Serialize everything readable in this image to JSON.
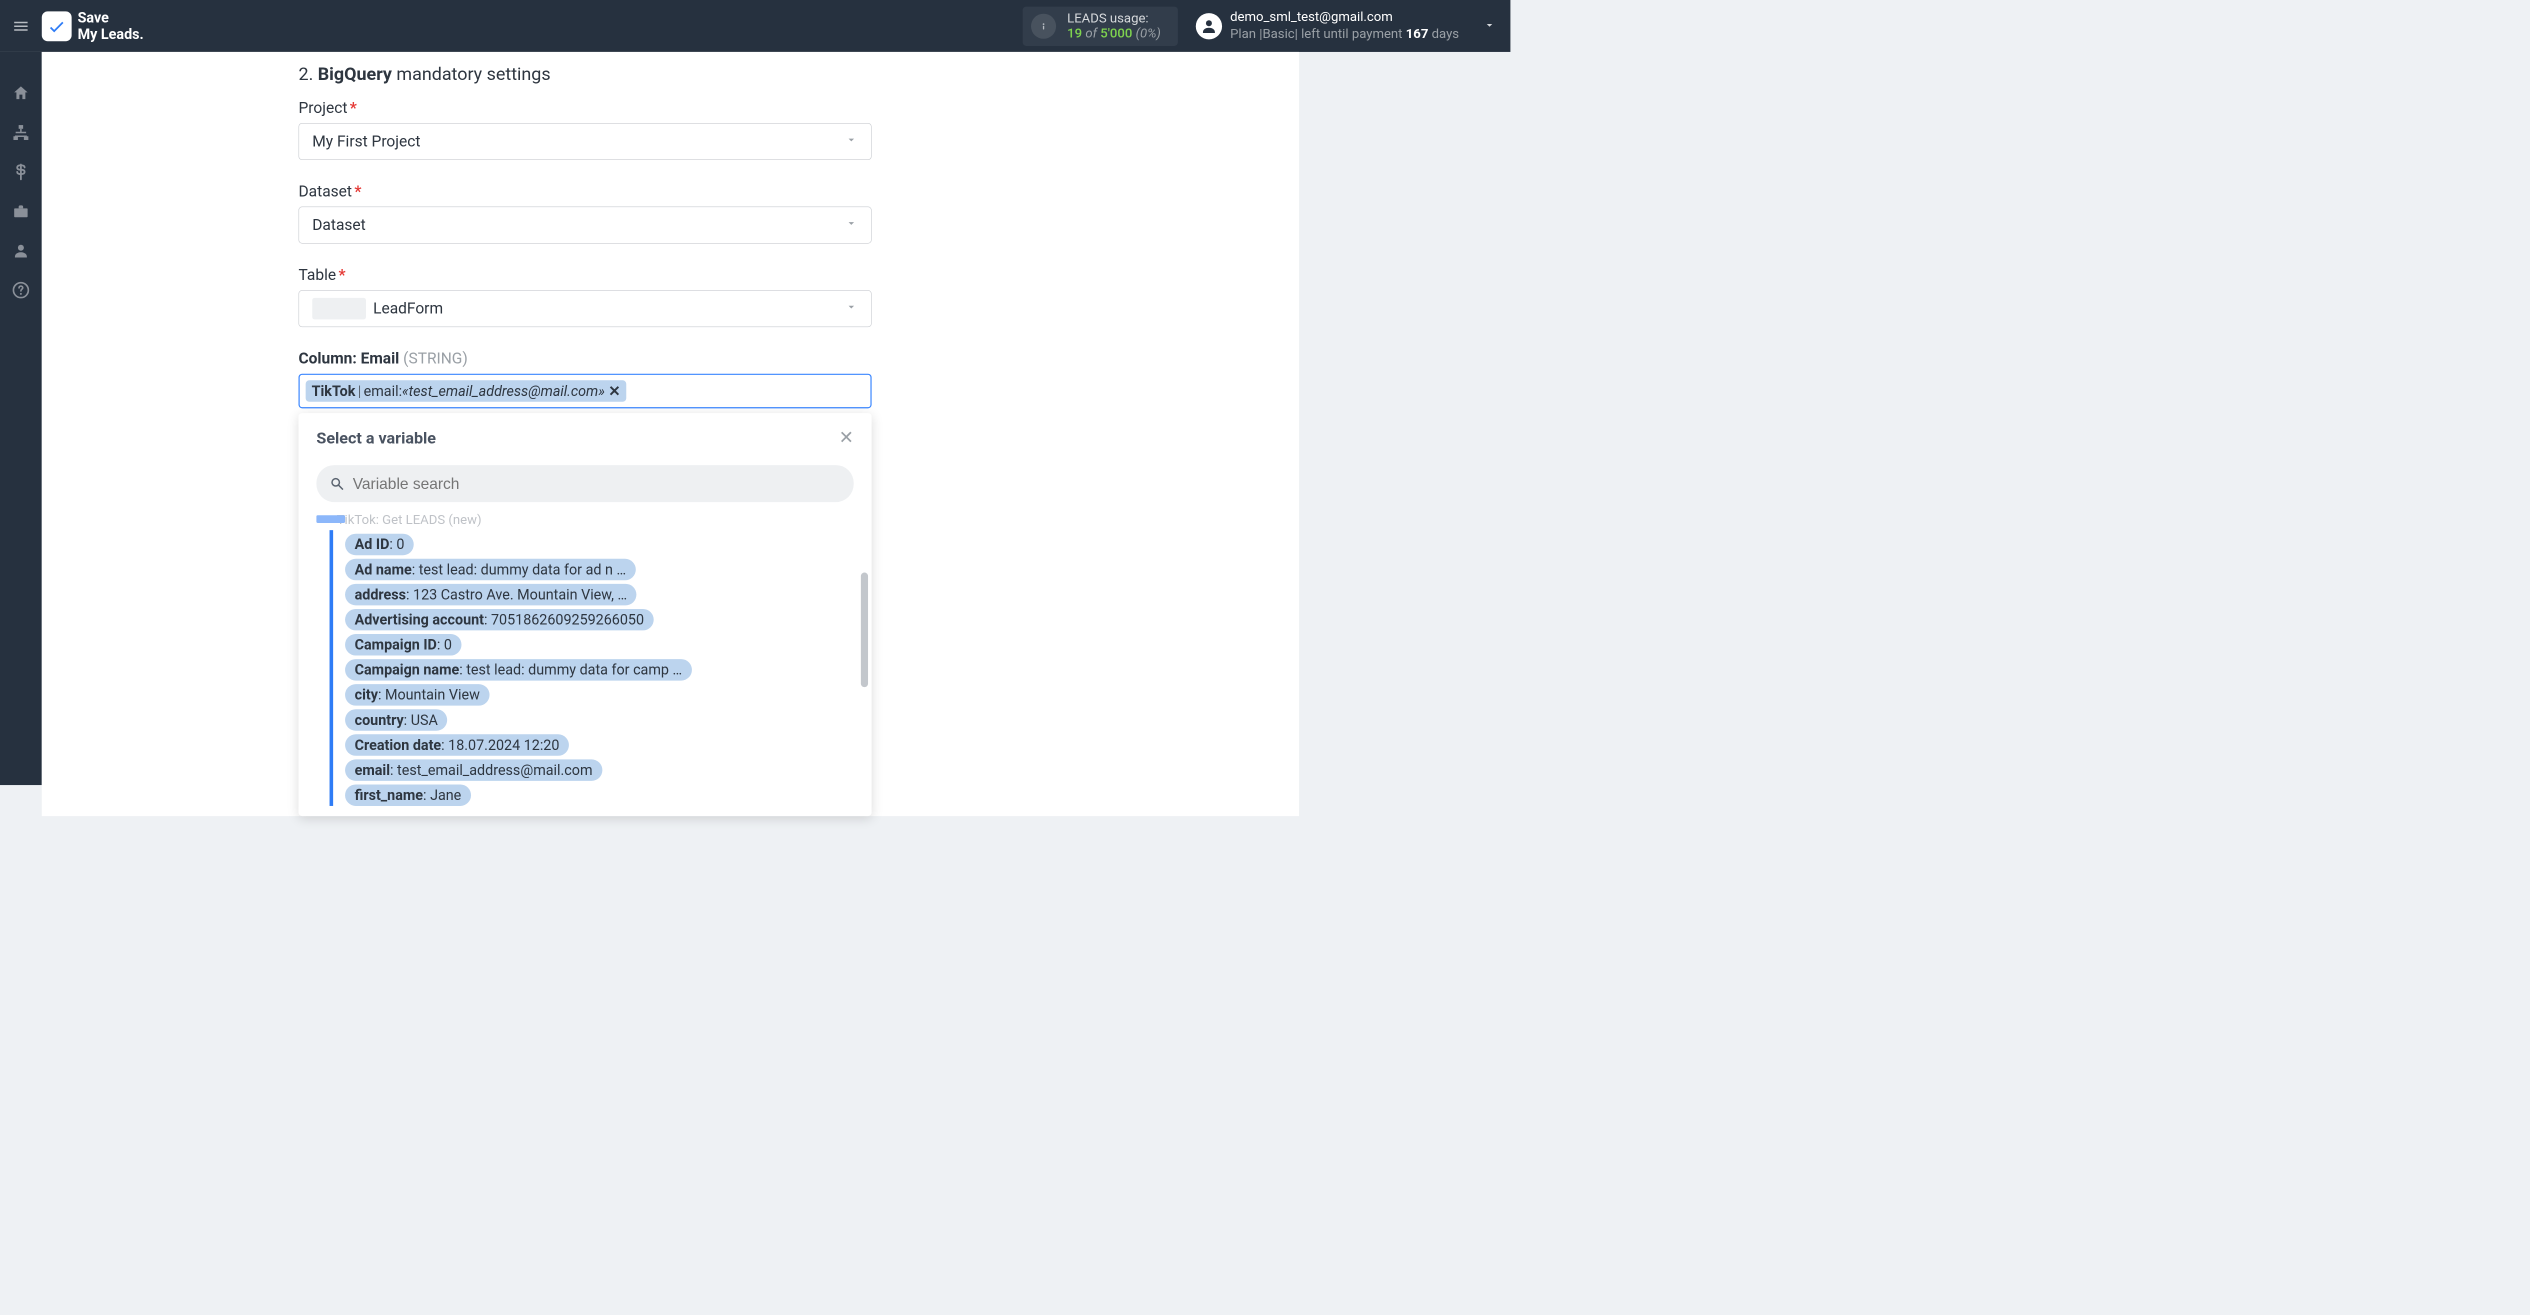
{
  "brand": {
    "line1": "Save",
    "line2": "My Leads."
  },
  "usage": {
    "label": "LEADS usage:",
    "used": "19",
    "of_word": "of",
    "limit": "5'000",
    "pct": "(0%)"
  },
  "user": {
    "email": "demo_sml_test@gmail.com",
    "plan_prefix": "Plan |Basic| left until payment ",
    "days_n": "167",
    "days_suffix": " days"
  },
  "section": {
    "number": "2.",
    "strong": "BigQuery",
    "rest": " mandatory settings"
  },
  "fields": {
    "project": {
      "label": "Project",
      "value": "My First Project"
    },
    "dataset": {
      "label": "Dataset",
      "value": "Dataset"
    },
    "table": {
      "label": "Table",
      "value": "LeadForm"
    }
  },
  "column": {
    "label": "Column: Email",
    "type": "(STRING)"
  },
  "chip": {
    "source": "TikTok",
    "sep": " | ",
    "field": "email: ",
    "value": "«test_email_address@mail.com»"
  },
  "dropdown": {
    "title": "Select a variable",
    "search_placeholder": "Variable search",
    "group_head": "TikTok: Get LEADS (new)",
    "items": [
      {
        "k": "Ad ID",
        "v": "0"
      },
      {
        "k": "Ad name",
        "v": "test lead: dummy data for ad n …"
      },
      {
        "k": "address",
        "v": "123 Castro Ave. Mountain View, …"
      },
      {
        "k": "Advertising account",
        "v": "7051862609259266050"
      },
      {
        "k": "Campaign ID",
        "v": "0"
      },
      {
        "k": "Campaign name",
        "v": "test lead: dummy data for camp …"
      },
      {
        "k": "city",
        "v": "Mountain View"
      },
      {
        "k": "country",
        "v": "USA"
      },
      {
        "k": "Creation date",
        "v": "18.07.2024 12:20"
      },
      {
        "k": "email",
        "v": "test_email_address@mail.com"
      },
      {
        "k": "first_name",
        "v": "Jane"
      }
    ]
  }
}
